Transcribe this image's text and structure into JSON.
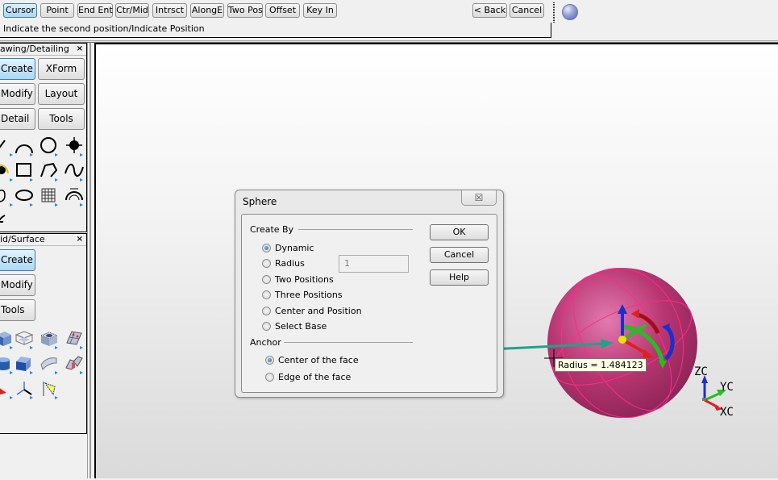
{
  "toolbar": {
    "snap_buttons": [
      {
        "label": "Cursor",
        "active": true
      },
      {
        "label": "Point",
        "active": false
      },
      {
        "label": "End Ent",
        "active": false
      },
      {
        "label": "Ctr/Mid",
        "active": false
      },
      {
        "label": "Intrsct",
        "active": false
      },
      {
        "label": "AlongE",
        "active": false
      },
      {
        "label": "Two Pos",
        "active": false
      },
      {
        "label": "Offset",
        "active": false
      },
      {
        "label": "Key In",
        "active": false
      }
    ],
    "back_label": "< Back",
    "cancel_label": "Cancel",
    "prompt": "Indicate the second position/Indicate Position",
    "orb_icon": "sphere-orb-icon"
  },
  "panels": {
    "drawing": {
      "title": "awing/Detailing",
      "close": "×",
      "buttons": [
        "Create",
        "XForm",
        "Modify",
        "Layout",
        "Detail",
        "Tools"
      ],
      "active": "Create",
      "tools": [
        "line-icon",
        "arc-icon",
        "circle-icon",
        "point-icon",
        "fillet-icon",
        "rectangle-icon",
        "polyline-icon",
        "spline-icon",
        "blend-icon",
        "ellipse-icon",
        "mesh-surface-icon",
        "hyperbola-icon",
        "freehand-icon"
      ]
    },
    "solid": {
      "title": "id/Surface",
      "close": "×",
      "buttons": [
        "Create",
        "Modify",
        "Tools"
      ],
      "active": "Create",
      "tools": [
        "box-icon",
        "shell-box-icon",
        "hole-icon",
        "patch-icon",
        "cylinder-icon",
        "extrude-icon",
        "loft-surface-icon",
        "split-surface-icon",
        "cone-icon",
        "axes-icon",
        "light-icon"
      ]
    }
  },
  "dialog": {
    "title": "Sphere",
    "close_glyph": "☒",
    "create_by_label": "Create By",
    "create_by_options": [
      {
        "label": "Dynamic",
        "checked": true
      },
      {
        "label": "Radius",
        "checked": false
      },
      {
        "label": "Two Positions",
        "checked": false
      },
      {
        "label": "Three Positions",
        "checked": false
      },
      {
        "label": "Center and Position",
        "checked": false
      },
      {
        "label": "Select Base",
        "checked": false
      }
    ],
    "radius_value": "1",
    "anchor_label": "Anchor",
    "anchor_options": [
      {
        "label": "Center of the face",
        "checked": true
      },
      {
        "label": "Edge of the face",
        "checked": false
      }
    ],
    "ok_label": "OK",
    "cancel_label": "Cancel",
    "help_label": "Help"
  },
  "viewport": {
    "tooltip": "Radius = 1.484123",
    "axes": {
      "z": "ZC",
      "y": "YC",
      "x": "XC"
    },
    "colors": {
      "sphere": "#b8336f",
      "annotation_arrow": "#1aa58a",
      "x_axis": "#e02020",
      "y_axis": "#22c022",
      "z_axis": "#1a2fd0"
    }
  }
}
